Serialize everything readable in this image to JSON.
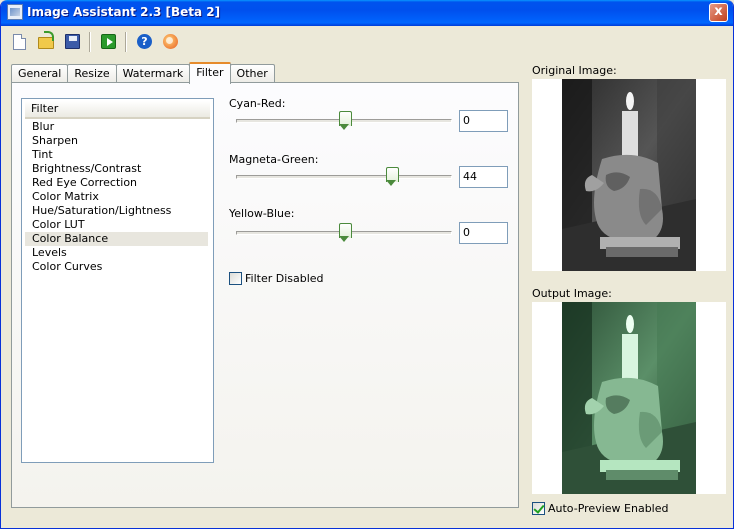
{
  "window": {
    "title": "Image Assistant 2.3 [Beta 2]",
    "close_label": "x"
  },
  "toolbar": {
    "items": [
      {
        "name": "new-icon"
      },
      {
        "name": "open-icon"
      },
      {
        "name": "save-icon"
      },
      {
        "name": "run-icon"
      },
      {
        "name": "help-icon"
      },
      {
        "name": "web-icon"
      }
    ]
  },
  "tabs": [
    {
      "label": "General"
    },
    {
      "label": "Resize"
    },
    {
      "label": "Watermark"
    },
    {
      "label": "Filter",
      "active": true
    },
    {
      "label": "Other"
    }
  ],
  "filter_list": {
    "header": "Filter",
    "items": [
      "Blur",
      "Sharpen",
      "Tint",
      "Brightness/Contrast",
      "Red Eye Correction",
      "Color Matrix",
      "Hue/Saturation/Lightness",
      "Color LUT",
      "Color Balance",
      "Levels",
      "Color Curves"
    ],
    "selected": "Color Balance"
  },
  "sliders": {
    "cyan_red": {
      "label": "Cyan-Red:",
      "value": "0",
      "level": 0.5
    },
    "magenta_green": {
      "label": "Magneta-Green:",
      "value": "44",
      "level": 0.72
    },
    "yellow_blue": {
      "label": "Yellow-Blue:",
      "value": "0",
      "level": 0.5
    }
  },
  "filter_disabled": {
    "label": "Filter Disabled",
    "checked": false
  },
  "preview": {
    "original_label": "Original Image:",
    "output_label": "Output Image:",
    "auto_preview_label": "Auto-Preview Enabled",
    "auto_preview_checked": true,
    "output_tint": "#7fe8a0"
  }
}
